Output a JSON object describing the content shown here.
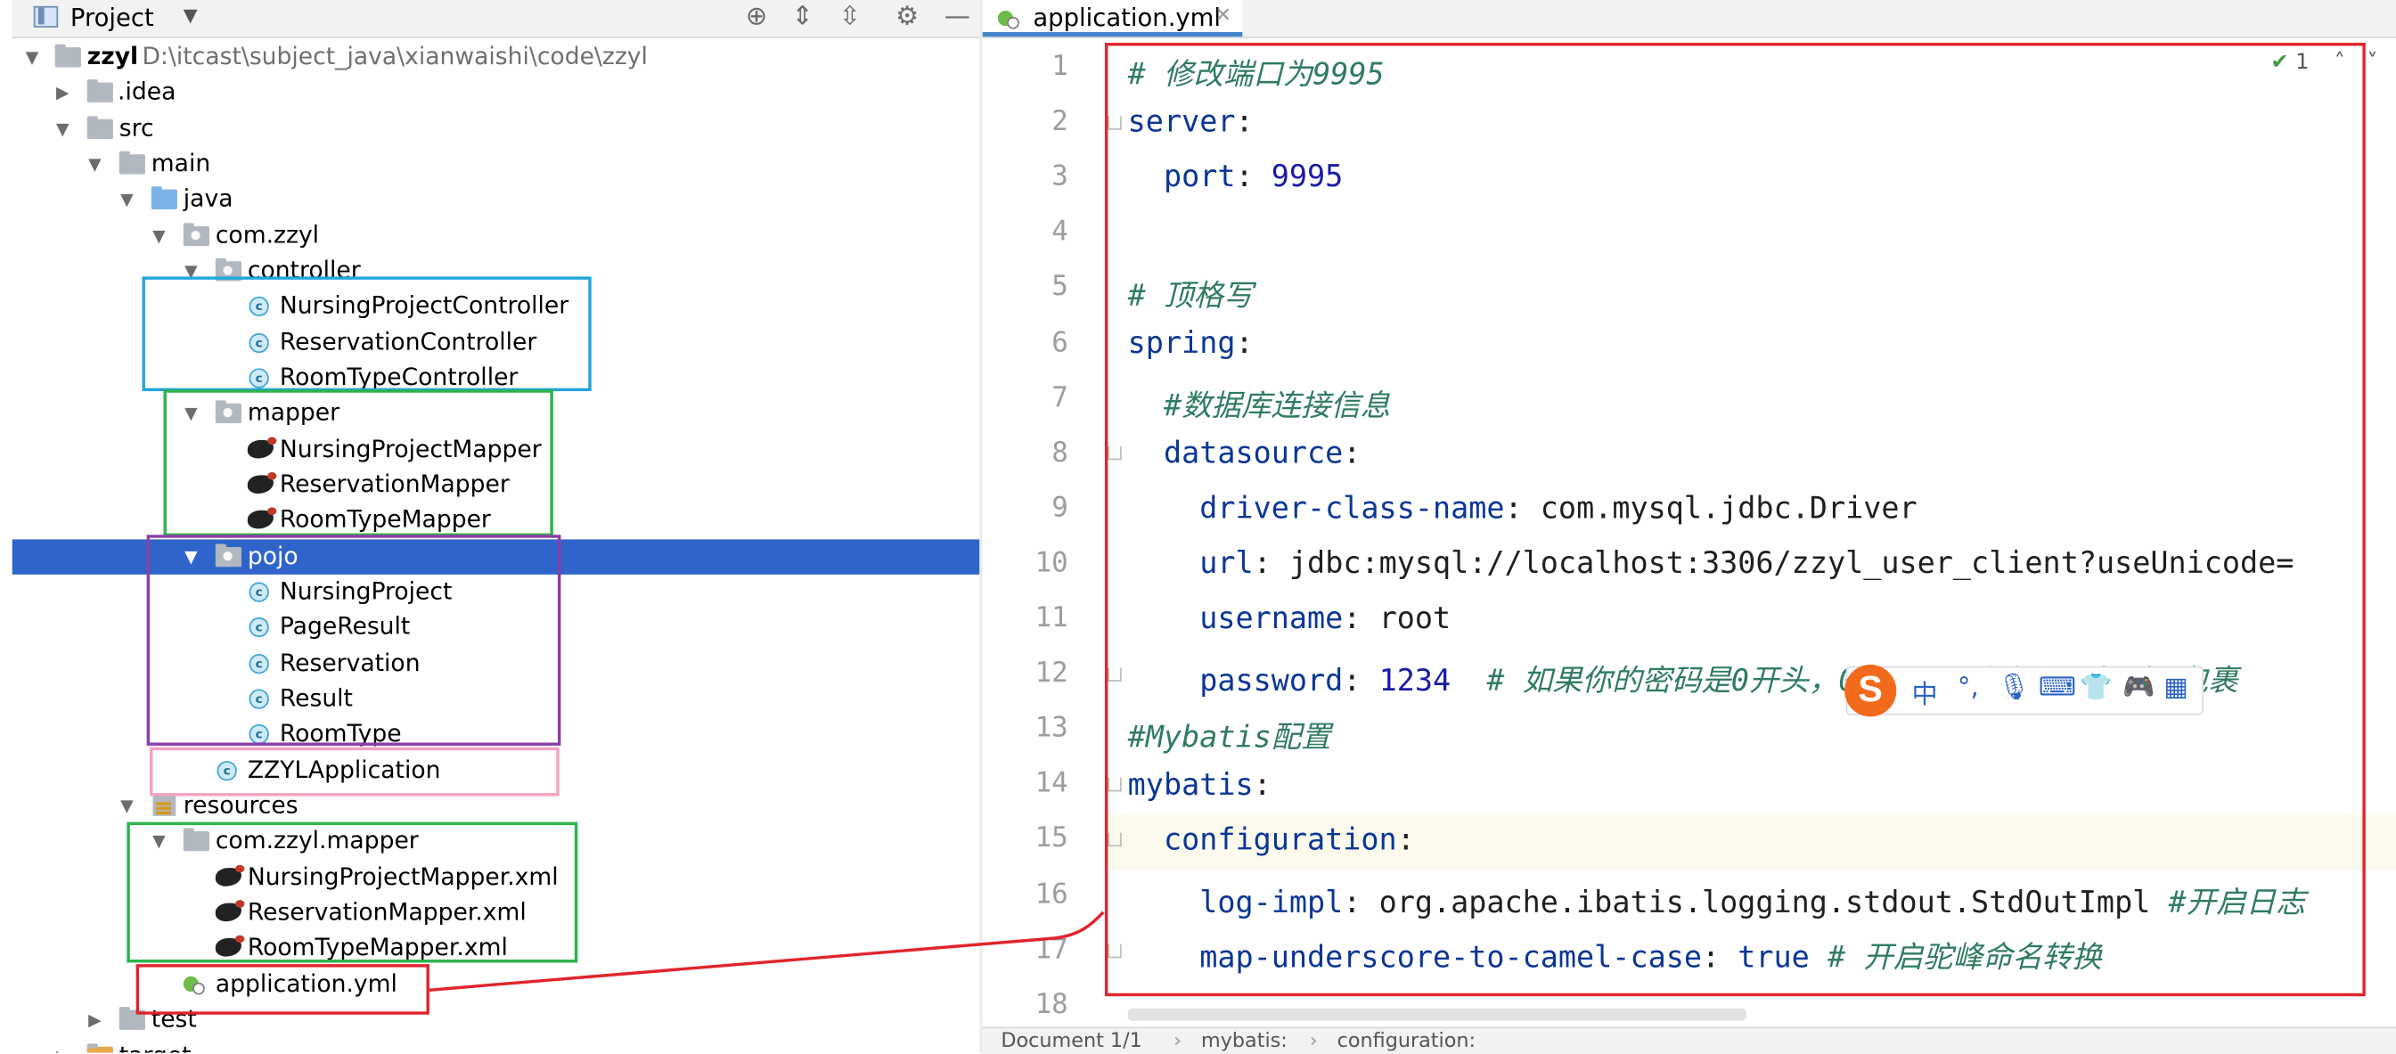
{
  "project_panel": {
    "title": "Project",
    "root": {
      "name": "zzyl",
      "path": "D:\\itcast\\subject_java\\xianwaishi\\code\\zzyl"
    },
    "items": {
      "idea": ".idea",
      "src": "src",
      "main": "main",
      "java": "java",
      "com_zzyl": "com.zzyl",
      "controller": "controller",
      "nursing_project_controller": "NursingProjectController",
      "reservation_controller": "ReservationController",
      "room_type_controller": "RoomTypeController",
      "mapper": "mapper",
      "nursing_project_mapper": "NursingProjectMapper",
      "reservation_mapper": "ReservationMapper",
      "room_type_mapper": "RoomTypeMapper",
      "pojo": "pojo",
      "nursing_project": "NursingProject",
      "page_result": "PageResult",
      "reservation": "Reservation",
      "result": "Result",
      "room_type": "RoomType",
      "zzyl_application": "ZZYLApplication",
      "resources": "resources",
      "com_zzyl_mapper": "com.zzyl.mapper",
      "nursing_project_mapper_xml": "NursingProjectMapper.xml",
      "reservation_mapper_xml": "ReservationMapper.xml",
      "room_type_mapper_xml": "RoomTypeMapper.xml",
      "application_yml": "application.yml",
      "test": "test",
      "target": "target"
    }
  },
  "editor": {
    "tab_name": "application.yml",
    "inspection_count": "1",
    "line_numbers": [
      "1",
      "2",
      "3",
      "4",
      "5",
      "6",
      "7",
      "8",
      "9",
      "10",
      "11",
      "12",
      "13",
      "14",
      "15",
      "16",
      "17",
      "18"
    ],
    "code": {
      "l1": "# 修改端口为9995",
      "l2_key": "server",
      "l3_key": "port",
      "l3_val": "9995",
      "l5": "# 顶格写",
      "l6_key": "spring",
      "l7": "#数据库连接信息",
      "l8_key": "datasource",
      "l9_key": "driver-class-name",
      "l9_val": "com.mysql.jdbc.Driver",
      "l10_key": "url",
      "l10_val": "jdbc:mysql://localhost:3306/zzyl_user_client?useUnicode=",
      "l11_key": "username",
      "l11_val": "root",
      "l12_key": "password",
      "l12_val": "1234",
      "l12_comment": "# 如果你的密码是0开头，0123，那么必须用但引号包裹",
      "l13": "#Mybatis配置",
      "l14_key": "mybatis",
      "l15_key": "configuration",
      "l16_key": "log-impl",
      "l16_val": "org.apache.ibatis.logging.stdout.StdOutImpl",
      "l16_comment": "#开启日志",
      "l17_key": "map-underscore-to-camel-case",
      "l17_val": "true",
      "l17_comment": "# 开启驼峰命名转换"
    },
    "status": {
      "doc": "Document 1/1",
      "crumb1": "mybatis:",
      "crumb2": "configuration:"
    }
  },
  "ime": {
    "logo": "S",
    "lang": "中",
    "punct": "°,"
  },
  "colors": {
    "selection": "#2f65ca",
    "box_blue": "#23a5dd",
    "box_green": "#2db34a",
    "box_purple": "#8b3fa6",
    "box_pink": "#f4a2c1",
    "box_red": "#e1242c"
  }
}
